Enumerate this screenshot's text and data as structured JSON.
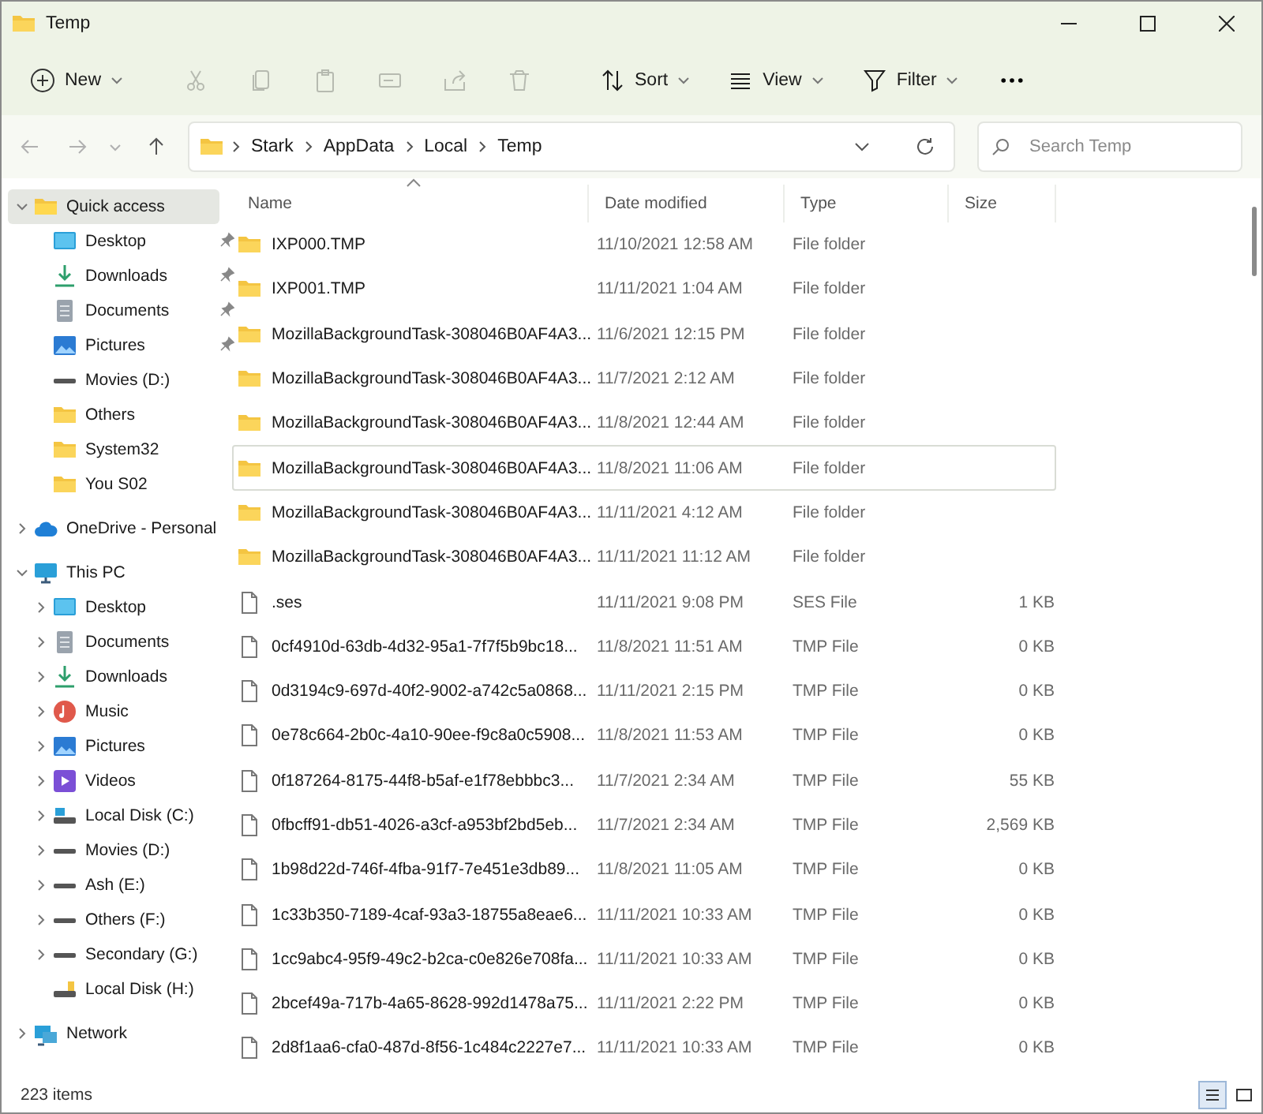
{
  "window": {
    "title": "Temp"
  },
  "toolbar": {
    "new": {
      "label": "New"
    },
    "actions": [
      {
        "kind": "cut",
        "disabled": true
      },
      {
        "kind": "copy",
        "disabled": true
      },
      {
        "kind": "paste",
        "disabled": true
      },
      {
        "kind": "rename",
        "disabled": true
      },
      {
        "kind": "share",
        "disabled": true
      },
      {
        "kind": "delete",
        "disabled": true
      }
    ],
    "menus": [
      {
        "kind": "sort",
        "label": "Sort"
      },
      {
        "kind": "view",
        "label": "View"
      },
      {
        "kind": "filter",
        "label": "Filter"
      }
    ]
  },
  "address": {
    "path": [
      "Stark",
      "AppData",
      "Local",
      "Temp"
    ]
  },
  "search": {
    "placeholder": "Search Temp"
  },
  "sidebar": {
    "items": [
      {
        "label": "Quick access",
        "kind": "star",
        "selected": true,
        "expanded": true,
        "children": [
          {
            "label": "Desktop",
            "kind": "desktop",
            "selected": false,
            "pinned": true
          },
          {
            "label": "Downloads",
            "kind": "downloads",
            "selected": false,
            "pinned": true
          },
          {
            "label": "Documents",
            "kind": "documents",
            "selected": false,
            "pinned": true
          },
          {
            "label": "Pictures",
            "kind": "pictures",
            "selected": false,
            "pinned": true
          },
          {
            "label": "Movies (D:)",
            "kind": "drive",
            "selected": false,
            "pinned": false
          },
          {
            "label": "Others",
            "kind": "folder",
            "selected": false,
            "pinned": false
          },
          {
            "label": "System32",
            "kind": "folder",
            "selected": false,
            "pinned": false
          },
          {
            "label": "You S02",
            "kind": "folder",
            "selected": false,
            "pinned": false
          }
        ]
      },
      {
        "label": "OneDrive - Personal",
        "kind": "cloud",
        "selected": false,
        "expanded": false
      },
      {
        "label": "This PC",
        "kind": "pc",
        "selected": false,
        "expanded": true,
        "children": [
          {
            "label": "Desktop",
            "kind": "desktop",
            "selected": false,
            "expanded": false
          },
          {
            "label": "Documents",
            "kind": "documents",
            "selected": false,
            "expanded": false
          },
          {
            "label": "Downloads",
            "kind": "downloads",
            "selected": false,
            "expanded": false
          },
          {
            "label": "Music",
            "kind": "music",
            "selected": false,
            "expanded": false
          },
          {
            "label": "Pictures",
            "kind": "pictures",
            "selected": false,
            "expanded": false
          },
          {
            "label": "Videos",
            "kind": "videos",
            "selected": false,
            "expanded": false
          },
          {
            "label": "Local Disk (C:)",
            "kind": "system-drive",
            "selected": false,
            "expanded": false
          },
          {
            "label": "Movies (D:)",
            "kind": "drive",
            "selected": false,
            "expanded": false
          },
          {
            "label": "Ash (E:)",
            "kind": "drive",
            "selected": false,
            "expanded": false
          },
          {
            "label": "Others (F:)",
            "kind": "drive",
            "selected": false,
            "expanded": false
          },
          {
            "label": "Secondary (G:)",
            "kind": "drive",
            "selected": false,
            "expanded": false
          },
          {
            "label": "Local Disk (H:)",
            "kind": "usb-drive",
            "selected": false
          }
        ]
      },
      {
        "label": "Network",
        "kind": "network",
        "selected": false,
        "expanded": false
      }
    ]
  },
  "table": {
    "columns": [
      "Name",
      "Date modified",
      "Type",
      "Size"
    ],
    "rows": [
      {
        "kind": "folder",
        "name": "IXP000.TMP",
        "date": "11/10/2021 12:58 AM",
        "type": "File folder",
        "focused": false
      },
      {
        "kind": "folder",
        "name": "IXP001.TMP",
        "date": "11/11/2021 1:04 AM",
        "type": "File folder",
        "focused": false
      },
      {
        "kind": "folder",
        "name": "MozillaBackgroundTask-308046B0AF4A3...",
        "date": "11/6/2021 12:15 PM",
        "type": "File folder",
        "focused": false
      },
      {
        "kind": "folder",
        "name": "MozillaBackgroundTask-308046B0AF4A3...",
        "date": "11/7/2021 2:12 AM",
        "type": "File folder",
        "focused": false
      },
      {
        "kind": "folder",
        "name": "MozillaBackgroundTask-308046B0AF4A3...",
        "date": "11/8/2021 12:44 AM",
        "type": "File folder",
        "focused": false
      },
      {
        "kind": "folder",
        "name": "MozillaBackgroundTask-308046B0AF4A3...",
        "date": "11/8/2021 11:06 AM",
        "type": "File folder",
        "focused": true
      },
      {
        "kind": "folder",
        "name": "MozillaBackgroundTask-308046B0AF4A3...",
        "date": "11/11/2021 4:12 AM",
        "type": "File folder",
        "focused": false
      },
      {
        "kind": "folder",
        "name": "MozillaBackgroundTask-308046B0AF4A3...",
        "date": "11/11/2021 11:12 AM",
        "type": "File folder",
        "focused": false
      },
      {
        "kind": "file",
        "name": ".ses",
        "date": "11/11/2021 9:08 PM",
        "type": "SES File",
        "size": "1 KB",
        "focused": false
      },
      {
        "kind": "file",
        "name": "0cf4910d-63db-4d32-95a1-7f7f5b9bc18...",
        "date": "11/8/2021 11:51 AM",
        "type": "TMP File",
        "size": "0 KB",
        "focused": false
      },
      {
        "kind": "file",
        "name": "0d3194c9-697d-40f2-9002-a742c5a0868...",
        "date": "11/11/2021 2:15 PM",
        "type": "TMP File",
        "size": "0 KB",
        "focused": false
      },
      {
        "kind": "file",
        "name": "0e78c664-2b0c-4a10-90ee-f9c8a0c5908...",
        "date": "11/8/2021 11:53 AM",
        "type": "TMP File",
        "size": "0 KB",
        "focused": false
      },
      {
        "kind": "file",
        "name": "0f187264-8175-44f8-b5af-e1f78ebbbc3...",
        "date": "11/7/2021 2:34 AM",
        "type": "TMP File",
        "size": "55 KB",
        "focused": false
      },
      {
        "kind": "file",
        "name": "0fbcff91-db51-4026-a3cf-a953bf2bd5eb...",
        "date": "11/7/2021 2:34 AM",
        "type": "TMP File",
        "size": "2,569 KB",
        "focused": false
      },
      {
        "kind": "file",
        "name": "1b98d22d-746f-4fba-91f7-7e451e3db89...",
        "date": "11/8/2021 11:05 AM",
        "type": "TMP File",
        "size": "0 KB",
        "focused": false
      },
      {
        "kind": "file",
        "name": "1c33b350-7189-4caf-93a3-18755a8eae6...",
        "date": "11/11/2021 10:33 AM",
        "type": "TMP File",
        "size": "0 KB",
        "focused": false
      },
      {
        "kind": "file",
        "name": "1cc9abc4-95f9-49c2-b2ca-c0e826e708fa...",
        "date": "11/11/2021 10:33 AM",
        "type": "TMP File",
        "size": "0 KB",
        "focused": false
      },
      {
        "kind": "file",
        "name": "2bcef49a-717b-4a65-8628-992d1478a75...",
        "date": "11/11/2021 2:22 PM",
        "type": "TMP File",
        "size": "0 KB",
        "focused": false
      },
      {
        "kind": "file",
        "name": "2d8f1aa6-cfa0-487d-8f56-1c484c2227e7...",
        "date": "11/11/2021 10:33 AM",
        "type": "TMP File",
        "size": "0 KB",
        "focused": false
      }
    ]
  },
  "status_bar": {
    "count": "223 items"
  },
  "view_modes": [
    {
      "kind": "details",
      "selected": true
    },
    {
      "kind": "tiles",
      "selected": false
    }
  ]
}
